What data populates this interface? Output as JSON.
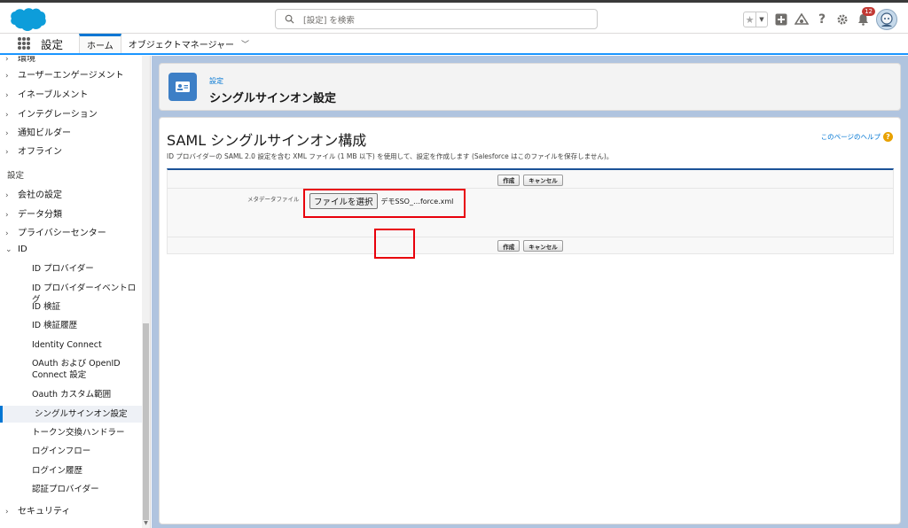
{
  "topbar": {
    "search_placeholder": "[設定] を検索",
    "notification_count": "12"
  },
  "nav": {
    "app_name": "設定",
    "tabs": [
      "ホーム",
      "オブジェクトマネージャー"
    ]
  },
  "sidebar": {
    "top_partial": "環境",
    "groups": [
      {
        "label": "ユーザーエンゲージメント"
      },
      {
        "label": "イネーブルメント"
      },
      {
        "label": "インテグレーション"
      },
      {
        "label": "通知ビルダー"
      },
      {
        "label": "オフライン"
      }
    ],
    "section_label": "設定",
    "groups2": [
      {
        "label": "会社の設定"
      },
      {
        "label": "データ分類"
      },
      {
        "label": "プライバシーセンター"
      },
      {
        "label": "ID"
      }
    ],
    "id_children": [
      "ID プロバイダー",
      "ID プロバイダーイベントログ",
      "ID 検証",
      "ID 検証履歴",
      "Identity Connect",
      "OAuth および OpenID Connect 設定",
      "Oauth カスタム範囲",
      "シングルサインオン設定",
      "トークン交換ハンドラー",
      "ログインフロー",
      "ログイン履歴",
      "認証プロバイダー"
    ],
    "active_child": "シングルサインオン設定",
    "bottom_group": "セキュリティ"
  },
  "header": {
    "breadcrumb": "設定",
    "title": "シングルサインオン設定"
  },
  "page": {
    "title": "SAML シングルサインオン構成",
    "help_link": "このページのヘルプ",
    "description": "ID プロバイダーの SAML 2.0 設定を含む XML ファイル (1 MB 以下) を使用して、設定を作成します (Salesforce はこのファイルを保存しません)。",
    "create_label": "作成",
    "cancel_label": "キャンセル",
    "metadata_label": "メタデータファイル",
    "choose_file_label": "ファイルを選択",
    "file_name": "デモSSO_…force.xml"
  },
  "colors": {
    "brand": "#0176d3",
    "highlight": "#e8000b"
  }
}
